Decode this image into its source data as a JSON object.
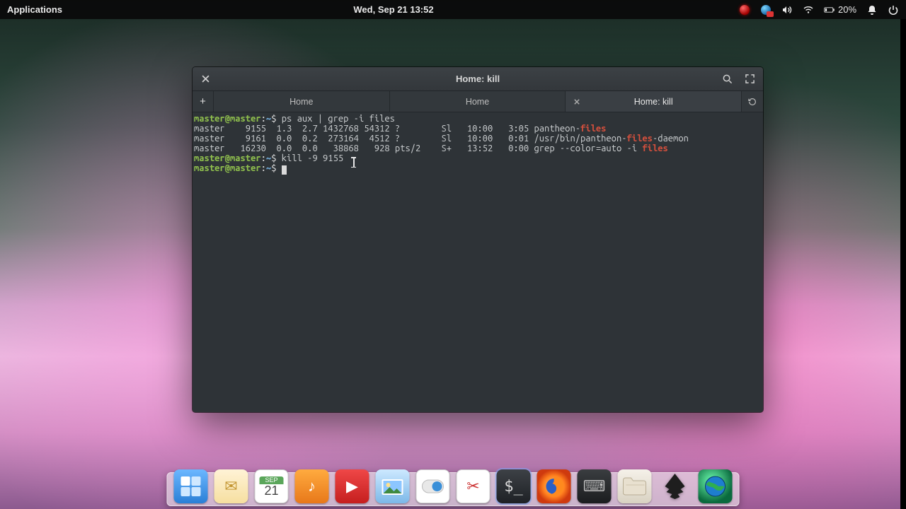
{
  "panel": {
    "applications": "Applications",
    "clock": "Wed, Sep 21   13:52",
    "battery": "20%"
  },
  "window": {
    "title": "Home: kill",
    "tabs": [
      {
        "label": "Home",
        "active": false,
        "closeable": false
      },
      {
        "label": "Home",
        "active": false,
        "closeable": true
      },
      {
        "label": "Home: kill",
        "active": true,
        "closeable": true
      }
    ]
  },
  "terminal": {
    "prompt_user": "master@master",
    "prompt_sep": ":",
    "prompt_path": "~",
    "prompt_end": "$",
    "cmd1": "ps aux | grep -i files",
    "rows": [
      {
        "user": "master",
        "pid": "9155",
        "cpu": "1.3",
        "mem": "2.7",
        "vsz": "1432768",
        "rss": "54312",
        "tty": "?",
        "stat": "Sl",
        "start": "10:00",
        "time": "3:05",
        "cmd_pre": "pantheon-",
        "cmd_hl": "files",
        "cmd_post": ""
      },
      {
        "user": "master",
        "pid": "9161",
        "cpu": "0.0",
        "mem": "0.2",
        "vsz": "273164",
        "rss": "4512",
        "tty": "?",
        "stat": "Sl",
        "start": "10:00",
        "time": "0:01",
        "cmd_pre": "/usr/bin/pantheon-",
        "cmd_hl": "files",
        "cmd_post": "-daemon"
      },
      {
        "user": "master",
        "pid": "16230",
        "cpu": "0.0",
        "mem": "0.0",
        "vsz": "38868",
        "rss": "928",
        "tty": "pts/2",
        "stat": "S+",
        "start": "13:52",
        "time": "0:00",
        "cmd_pre": "grep --color=auto -i ",
        "cmd_hl": "files",
        "cmd_post": ""
      }
    ],
    "cmd2": "kill -9 9155"
  },
  "dock": {
    "items": [
      {
        "name": "workspace-switcher",
        "glyph": ""
      },
      {
        "name": "mail",
        "glyph": "✉"
      },
      {
        "name": "calendar",
        "glyph": "21"
      },
      {
        "name": "music",
        "glyph": "♪"
      },
      {
        "name": "videos",
        "glyph": "▶"
      },
      {
        "name": "photos",
        "glyph": "▦"
      },
      {
        "name": "switchboard",
        "glyph": ""
      },
      {
        "name": "screenshot",
        "glyph": "✂"
      },
      {
        "name": "terminal",
        "glyph": "$_"
      },
      {
        "name": "firefox",
        "glyph": ""
      },
      {
        "name": "keyboard",
        "glyph": "⌨"
      },
      {
        "name": "files",
        "glyph": ""
      },
      {
        "name": "inkscape",
        "glyph": ""
      },
      {
        "name": "globe",
        "glyph": ""
      }
    ]
  }
}
